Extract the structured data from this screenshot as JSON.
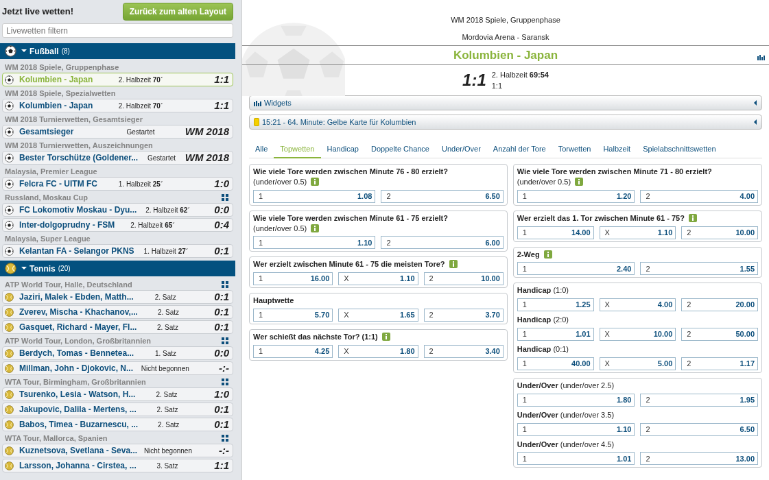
{
  "sidebar": {
    "title": "Jetzt live wetten!",
    "back_button": "Zurück zum alten Layout",
    "filter": {
      "placeholder": "Livewetten filtern"
    },
    "sports": [
      {
        "kind": "football",
        "name": "Fußball",
        "count": "(8)",
        "expanded": true,
        "groups": [
          {
            "title": "WM 2018 Spiele, Gruppenphase",
            "grid_icon": false,
            "events": [
              {
                "name": "Kolumbien - Japan",
                "status": "2. Halbzeit **70´**",
                "score": "1:1",
                "selected": true
              }
            ]
          },
          {
            "title": "WM 2018 Spiele, Spezialwetten",
            "grid_icon": false,
            "events": [
              {
                "name": "Kolumbien - Japan",
                "status": "2. Halbzeit **70´**",
                "score": "1:1",
                "selected": false
              }
            ]
          },
          {
            "title": "WM 2018 Turnierwetten, Gesamtsieger",
            "grid_icon": false,
            "events": [
              {
                "name": "Gesamtsieger",
                "status": "Gestartet",
                "score": "WM 2018",
                "selected": false
              }
            ]
          },
          {
            "title": "WM 2018 Turnierwetten, Auszeichnungen",
            "grid_icon": false,
            "events": [
              {
                "name": "Bester Torschütze (Goldener...",
                "status": "Gestartet",
                "score": "WM 2018",
                "selected": false
              }
            ]
          },
          {
            "title": "Malaysia, Premier League",
            "grid_icon": false,
            "events": [
              {
                "name": "Felcra FC - UITM FC",
                "status": "1. Halbzeit **25´**",
                "score": "1:0",
                "selected": false
              }
            ]
          },
          {
            "title": "Russland, Moskau Cup",
            "grid_icon": true,
            "events": [
              {
                "name": "FC Lokomotiv Moskau - Dyu...",
                "status": "2. Halbzeit **62´**",
                "score": "0:0",
                "selected": false
              },
              {
                "name": "Inter-dolgoprudny - FSM",
                "status": "2. Halbzeit **65´**",
                "score": "0:4",
                "selected": false
              }
            ]
          },
          {
            "title": "Malaysia, Super League",
            "grid_icon": false,
            "events": [
              {
                "name": "Kelantan FA - Selangor PKNS",
                "status": "1. Halbzeit **27´**",
                "score": "0:1",
                "selected": false
              }
            ]
          }
        ]
      },
      {
        "kind": "tennis",
        "name": "Tennis",
        "count": "(20)",
        "expanded": true,
        "groups": [
          {
            "title": "ATP World Tour, Halle, Deutschland",
            "grid_icon": true,
            "events": [
              {
                "name": "Jaziri, Malek - Ebden, Matth...",
                "status": "2. Satz",
                "score": "0:1",
                "selected": false
              },
              {
                "name": "Zverev, Mischa - Khachanov,...",
                "status": "2. Satz",
                "score": "0:1",
                "selected": false
              },
              {
                "name": "Gasquet, Richard - Mayer, Fl...",
                "status": "2. Satz",
                "score": "0:1",
                "selected": false
              }
            ]
          },
          {
            "title": "ATP World Tour, London, Großbritannien",
            "grid_icon": true,
            "events": [
              {
                "name": "Berdych, Tomas - Bennetea...",
                "status": "1. Satz",
                "score": "0:0",
                "selected": false
              },
              {
                "name": "Millman, John - Djokovic, N...",
                "status": "Nicht begonnen",
                "score": "-:-",
                "selected": false
              }
            ]
          },
          {
            "title": "WTA Tour, Birmingham, Großbritannien",
            "grid_icon": true,
            "events": [
              {
                "name": "Tsurenko, Lesia - Watson, H...",
                "status": "2. Satz",
                "score": "1:0",
                "selected": false
              },
              {
                "name": "Jakupovic, Dalila - Mertens, ...",
                "status": "2. Satz",
                "score": "0:1",
                "selected": false
              },
              {
                "name": "Babos, Timea - Buzarnescu, ...",
                "status": "2. Satz",
                "score": "0:1",
                "selected": false
              }
            ]
          },
          {
            "title": "WTA Tour, Mallorca, Spanien",
            "grid_icon": true,
            "events": [
              {
                "name": "Kuznetsova, Svetlana - Seva...",
                "status": "Nicht begonnen",
                "score": "-:-",
                "selected": false
              },
              {
                "name": "Larsson, Johanna - Cirstea, ...",
                "status": "3. Satz",
                "score": "1:1",
                "selected": false
              }
            ]
          }
        ]
      }
    ]
  },
  "match": {
    "competition": "WM 2018 Spiele, Gruppenphase",
    "venue": "Mordovia Arena - Saransk",
    "title": "Kolumbien - Japan",
    "score": "1:1",
    "period": "2. Halbzeit **69:54**",
    "half_score": "1:1"
  },
  "panels": [
    {
      "kind": "widgets",
      "label": "Widgets",
      "expanded": false
    },
    {
      "kind": "card",
      "label": "15:21 - 64. Minute: Gelbe Karte für Kolumbien",
      "expanded": false
    }
  ],
  "tabs": [
    {
      "label": "Alle",
      "selected": false
    },
    {
      "label": "Topwetten",
      "selected": true
    },
    {
      "label": "Handicap",
      "selected": false
    },
    {
      "label": "Doppelte Chance",
      "selected": false
    },
    {
      "label": "Under/Over",
      "selected": false
    },
    {
      "label": "Anzahl der Tore",
      "selected": false
    },
    {
      "label": "Torwetten",
      "selected": false
    },
    {
      "label": "Halbzeit",
      "selected": false
    },
    {
      "label": "Spielabschnittswetten",
      "selected": false
    }
  ],
  "market_columns": [
    [
      {
        "lines": [
          {
            "title": "**Wie viele Tore werden zwischen Minute 76 - 80 erzielt?**",
            "note": "(under/over 0.5)",
            "info": true,
            "odds": [
              {
                "label": "1",
                "value": "1.08"
              },
              {
                "label": "2",
                "value": "6.50"
              }
            ]
          }
        ]
      },
      {
        "lines": [
          {
            "title": "**Wie viele Tore werden zwischen Minute 61 - 75 erzielt?**",
            "note": "(under/over 0.5)",
            "info": true,
            "odds": [
              {
                "label": "1",
                "value": "1.10"
              },
              {
                "label": "2",
                "value": "6.00"
              }
            ]
          }
        ]
      },
      {
        "lines": [
          {
            "title": "**Wer erzielt zwischen Minute 61 - 75 die meisten Tore?**",
            "info": true,
            "odds": [
              {
                "label": "1",
                "value": "16.00"
              },
              {
                "label": "X",
                "value": "1.10"
              },
              {
                "label": "2",
                "value": "10.00"
              }
            ]
          }
        ]
      },
      {
        "lines": [
          {
            "title": "**Hauptwette**",
            "info": false,
            "odds": [
              {
                "label": "1",
                "value": "5.70"
              },
              {
                "label": "X",
                "value": "1.65"
              },
              {
                "label": "2",
                "value": "3.70"
              }
            ]
          }
        ]
      },
      {
        "lines": [
          {
            "title": "**Wer schießt das nächste Tor? (1:1)**",
            "info": true,
            "odds": [
              {
                "label": "1",
                "value": "4.25"
              },
              {
                "label": "X",
                "value": "1.80"
              },
              {
                "label": "2",
                "value": "3.40"
              }
            ]
          }
        ]
      }
    ],
    [
      {
        "lines": [
          {
            "title": "**Wie viele Tore werden zwischen Minute 71 - 80 erzielt?**",
            "note": "(under/over 0.5)",
            "info": true,
            "odds": [
              {
                "label": "1",
                "value": "1.20"
              },
              {
                "label": "2",
                "value": "4.00"
              }
            ]
          }
        ]
      },
      {
        "lines": [
          {
            "title": "**Wer erzielt das 1. Tor zwischen Minute 61 - 75?**",
            "info": true,
            "odds": [
              {
                "label": "1",
                "value": "14.00"
              },
              {
                "label": "X",
                "value": "1.10"
              },
              {
                "label": "2",
                "value": "10.00"
              }
            ]
          }
        ]
      },
      {
        "lines": [
          {
            "title": "**2-Weg**",
            "info": true,
            "odds": [
              {
                "label": "1",
                "value": "2.40"
              },
              {
                "label": "2",
                "value": "1.55"
              }
            ]
          }
        ]
      },
      {
        "lines": [
          {
            "title": "**Handicap** (1:0)",
            "info": false,
            "odds": [
              {
                "label": "1",
                "value": "1.25"
              },
              {
                "label": "X",
                "value": "4.00"
              },
              {
                "label": "2",
                "value": "20.00"
              }
            ]
          },
          {
            "title": "**Handicap** (2:0)",
            "info": false,
            "odds": [
              {
                "label": "1",
                "value": "1.01"
              },
              {
                "label": "X",
                "value": "10.00"
              },
              {
                "label": "2",
                "value": "50.00"
              }
            ]
          },
          {
            "title": "**Handicap** (0:1)",
            "info": false,
            "odds": [
              {
                "label": "1",
                "value": "40.00"
              },
              {
                "label": "X",
                "value": "5.00"
              },
              {
                "label": "2",
                "value": "1.17"
              }
            ]
          }
        ]
      },
      {
        "lines": [
          {
            "title": "**Under/Over** (under/over 2.5)",
            "info": false,
            "odds": [
              {
                "label": "1",
                "value": "1.80"
              },
              {
                "label": "2",
                "value": "1.95"
              }
            ]
          },
          {
            "title": "**Under/Over** (under/over 3.5)",
            "info": false,
            "odds": [
              {
                "label": "1",
                "value": "1.10"
              },
              {
                "label": "2",
                "value": "6.50"
              }
            ]
          },
          {
            "title": "**Under/Over** (under/over 4.5)",
            "info": false,
            "odds": [
              {
                "label": "1",
                "value": "1.01"
              },
              {
                "label": "2",
                "value": "13.00"
              }
            ]
          }
        ]
      }
    ]
  ]
}
